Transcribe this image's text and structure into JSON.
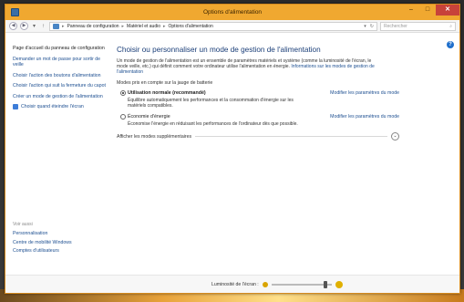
{
  "window": {
    "title": "Options d'alimentation",
    "close_glyph": "✕",
    "minimize_glyph": "–",
    "maximize_glyph": "□"
  },
  "address": {
    "breadcrumbs": [
      "Panneau de configuration",
      "Matériel et audio",
      "Options d'alimentation"
    ],
    "search_placeholder": "Rechercher"
  },
  "sidebar": {
    "items": [
      {
        "label": "Page d'accueil du panneau de configuration"
      },
      {
        "label": "Demander un mot de passe pour sortir de veille"
      },
      {
        "label": "Choisir l'action des boutons d'alimentation"
      },
      {
        "label": "Choisir l'action qui suit la fermeture du capot"
      },
      {
        "label": "Créer un mode de gestion de l'alimentation"
      },
      {
        "label": "Choisir quand éteindre l'écran"
      }
    ],
    "see_also": "Voir aussi",
    "see_also_links": [
      {
        "label": "Personnalisation"
      },
      {
        "label": "Centre de mobilité Windows"
      },
      {
        "label": "Comptes d'utilisateurs"
      }
    ]
  },
  "main": {
    "heading": "Choisir ou personnaliser un mode de gestion de l'alimentation",
    "description": "Un mode de gestion de l'alimentation est un ensemble de paramètres matériels et système (comme la luminosité de l'écran, le mode veille, etc.) qui définit comment votre ordinateur utilise l'alimentation en énergie.",
    "info_link": "Informations sur les modes de gestion de l'alimentation",
    "section_label": "Modes pris en compte sur la jauge de batterie",
    "plans": [
      {
        "name": "Utilisation normale (recommandé)",
        "selected": true,
        "link": "Modifier les paramètres du mode",
        "desc": "Équilibre automatiquement les performances et la consommation d'énergie sur les matériels compatibles."
      },
      {
        "name": "Économie d'énergie",
        "selected": false,
        "link": "Modifier les paramètres du mode",
        "desc": "Économise l'énergie en réduisant les performances de l'ordinateur dès que possible."
      }
    ],
    "more_plans": "Afficher les modes supplémentaires"
  },
  "status": {
    "brightness_label": "Luminosité de l'écran :",
    "brightness_level_percent": 90
  },
  "colors": {
    "accent": "#f0a830",
    "link": "#1d4f91",
    "heading": "#1a3e78"
  }
}
